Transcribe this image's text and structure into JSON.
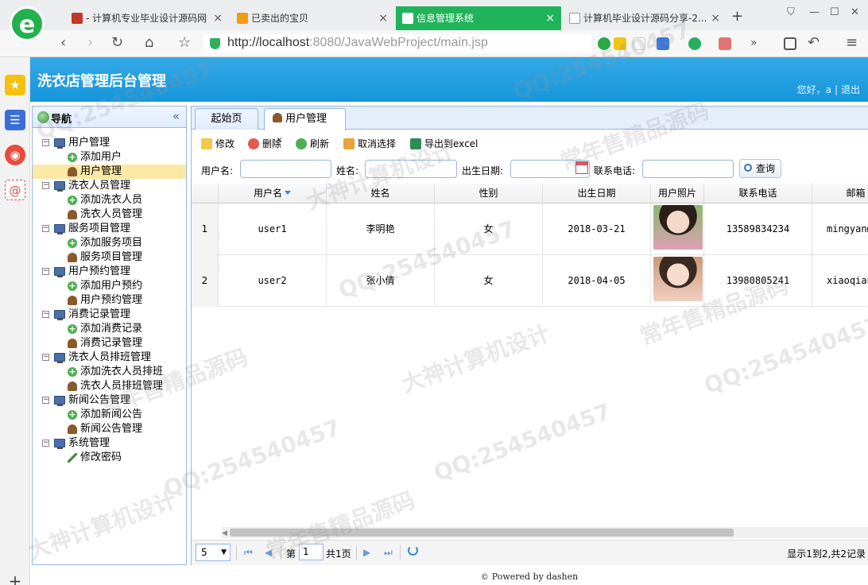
{
  "browser": {
    "logo": "e",
    "tabs": [
      {
        "title": "- 计算机专业毕业设计源码网",
        "close": "×"
      },
      {
        "title": "已卖出的宝贝",
        "close": "×"
      },
      {
        "title": "信息管理系统",
        "close": "×"
      },
      {
        "title": "计算机毕业设计源码分享-2...",
        "close": "×"
      }
    ],
    "new_tab": "+",
    "url_host": "http://localhost",
    "url_rest": ":8080/JavaWebProject/main.jsp"
  },
  "app": {
    "title": "洗衣店管理后台管理",
    "greeting": "您好，a",
    "logout": "退出",
    "footer": "Powered by dashen",
    "footer_icon": "©"
  },
  "nav": {
    "title": "导航",
    "collapse": "«",
    "groups": [
      {
        "label": "用户管理",
        "children": [
          {
            "label": "添加用户",
            "icon": "add-icon"
          },
          {
            "label": "用户管理",
            "icon": "person-icon",
            "selected": true
          }
        ]
      },
      {
        "label": "洗衣人员管理",
        "children": [
          {
            "label": "添加洗衣人员",
            "icon": "add-icon"
          },
          {
            "label": "洗衣人员管理",
            "icon": "person-icon"
          }
        ]
      },
      {
        "label": "服务项目管理",
        "children": [
          {
            "label": "添加服务项目",
            "icon": "add-icon"
          },
          {
            "label": "服务项目管理",
            "icon": "person-icon"
          }
        ]
      },
      {
        "label": "用户预约管理",
        "children": [
          {
            "label": "添加用户预约",
            "icon": "add-icon"
          },
          {
            "label": "用户预约管理",
            "icon": "person-icon"
          }
        ]
      },
      {
        "label": "消费记录管理",
        "children": [
          {
            "label": "添加消费记录",
            "icon": "add-icon"
          },
          {
            "label": "消费记录管理",
            "icon": "person-icon"
          }
        ]
      },
      {
        "label": "洗衣人员排班管理",
        "children": [
          {
            "label": "添加洗衣人员排班",
            "icon": "add-icon"
          },
          {
            "label": "洗衣人员排班管理",
            "icon": "person-icon"
          }
        ]
      },
      {
        "label": "新闻公告管理",
        "children": [
          {
            "label": "添加新闻公告",
            "icon": "add-icon"
          },
          {
            "label": "新闻公告管理",
            "icon": "person-icon"
          }
        ]
      },
      {
        "label": "系统管理",
        "children": [
          {
            "label": "修改密码",
            "icon": "pencil-icon"
          }
        ]
      }
    ]
  },
  "tabs": [
    {
      "label": "起始页"
    },
    {
      "label": "用户管理",
      "close": "×"
    }
  ],
  "toolbar": {
    "edit": "修改",
    "delete": "删除",
    "refresh": "刷新",
    "unselect": "取消选择",
    "export": "导出到excel"
  },
  "search": {
    "username_label": "用户名:",
    "name_label": "姓名:",
    "birth_label": "出生日期:",
    "phone_label": "联系电话:",
    "query": "查询"
  },
  "grid": {
    "columns": [
      "用户名",
      "姓名",
      "性别",
      "出生日期",
      "用户照片",
      "联系电话",
      "邮箱"
    ],
    "rows": [
      {
        "num": "1",
        "username": "user1",
        "name": "李明艳",
        "gender": "女",
        "birth": "2018-03-21",
        "phone": "13589834234",
        "email": "mingyan@"
      },
      {
        "num": "2",
        "username": "user2",
        "name": "张小倩",
        "gender": "女",
        "birth": "2018-04-05",
        "phone": "13980805241",
        "email": "xiaoqian@"
      }
    ]
  },
  "pager": {
    "page_size": "5",
    "page_label": "第",
    "page_value": "1",
    "total_pages": "共1页",
    "info": "显示1到2,共2记录"
  },
  "watermarks": [
    "QQ:254540457",
    "常年售精品源码",
    "大神计算机设计"
  ]
}
